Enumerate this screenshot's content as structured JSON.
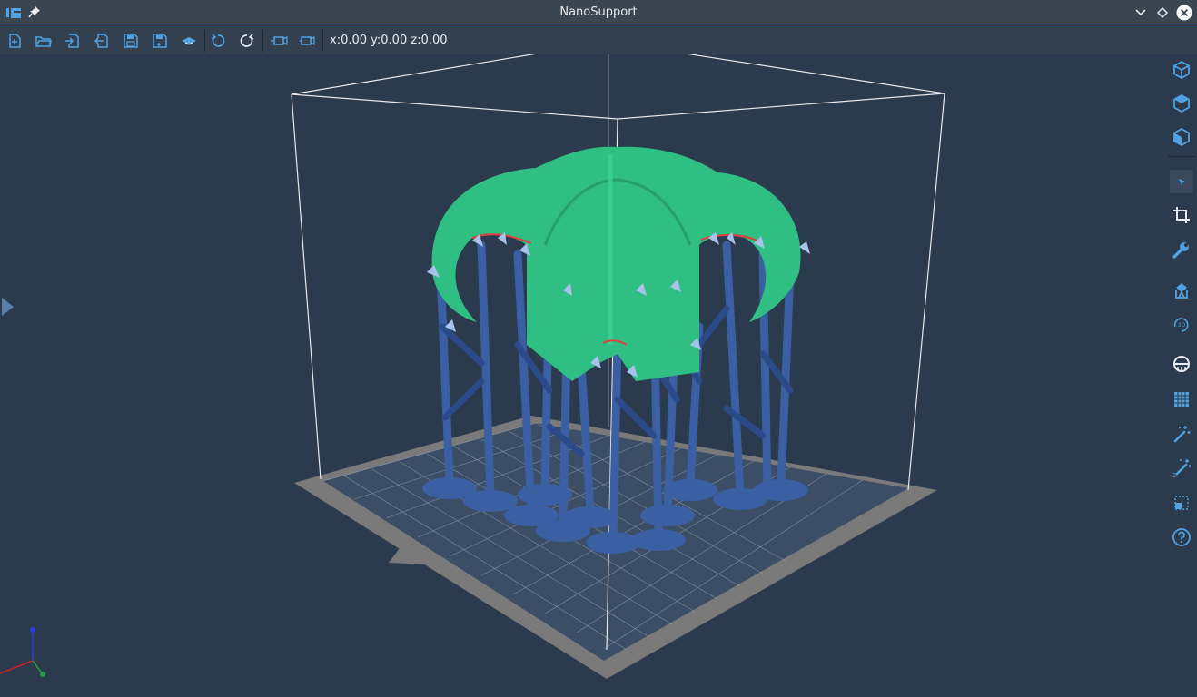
{
  "window": {
    "title": "NanoSupport"
  },
  "toolbar": {
    "coordinates": "x:0.00 y:0.00 z:0.00",
    "buttons": [
      "new-project",
      "open-project",
      "import-model",
      "export-model",
      "save",
      "save-as",
      "slice",
      "undo",
      "redo",
      "camera-left",
      "camera-right"
    ]
  },
  "right_toolbar": {
    "items": [
      "view-iso",
      "view-top",
      "view-front",
      "select",
      "crop",
      "wrench",
      "support-tool",
      "rotate-3d",
      "hollow",
      "grid",
      "auto-support",
      "auto-support-2",
      "fit-select",
      "help"
    ],
    "active": "select"
  },
  "colors": {
    "background": "#2b3a4d",
    "titlebar": "#3a4552",
    "toolbar": "#33404f",
    "accent": "#4fa3e3",
    "model": "#2fbf83",
    "support": "#3b5fa3",
    "support_dark": "#2a4a8a",
    "support_tip": "#a9c2ec",
    "plate": "#7a7a7a",
    "bounding_box": "#ffffff"
  }
}
